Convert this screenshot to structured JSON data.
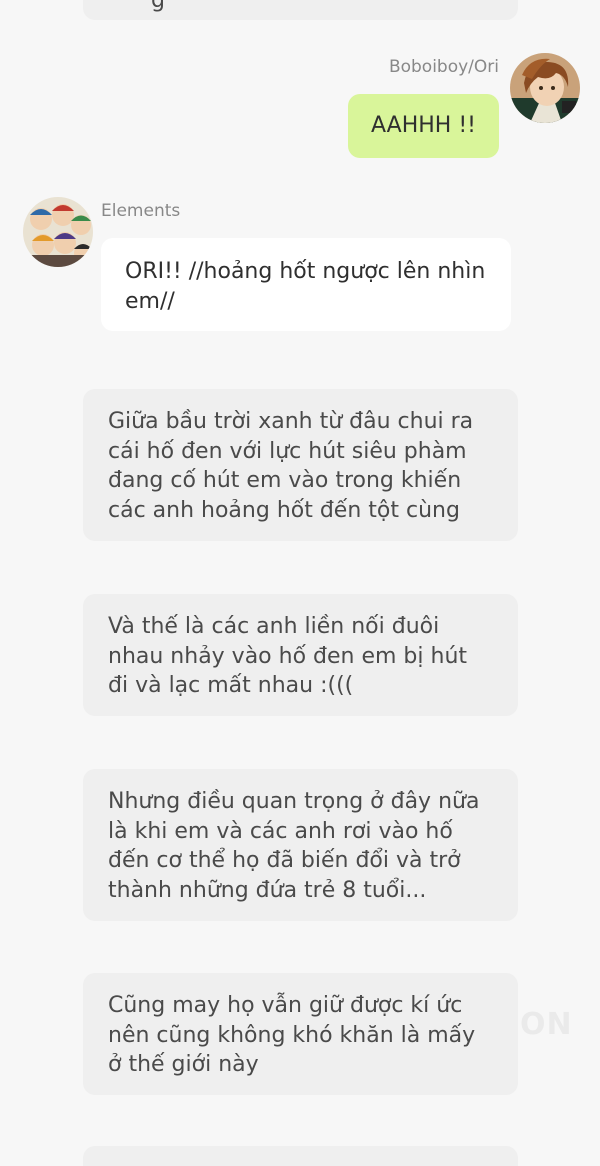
{
  "messages": {
    "top_partial": "g",
    "ori": {
      "name": "Boboiboy/Ori",
      "text": "AAHHH !!"
    },
    "elements": {
      "name": "Elements",
      "text": "ORI!! //hoảng hốt ngược lên nhìn em//"
    },
    "narration": [
      "Giữa bầu trời xanh từ đâu chui ra cái hố đen với lực hút siêu phàm đang cố hút em vào trong khiến các anh hoảng hốt đến tột cùng",
      "Và thế là các anh liền nối đuôi nhau nhảy vào hố đen em bị hút đi và lạc mất nhau :(((",
      "Nhưng điều quan trọng ở đây nữa là khi em và các anh rơi vào hố đến cơ thể họ đã biến đổi và trở thành những đứa trẻ 8 tuổi...",
      "Cũng may họ vẫn giữ được kí ức nên cũng không khó khăn là mấy ở thế giới này"
    ]
  },
  "watermark": "ON",
  "colors": {
    "sent_bubble": "#d9f59a",
    "received_bubble": "#ffffff",
    "narration_bubble": "#efefef",
    "background": "#f7f7f7"
  }
}
